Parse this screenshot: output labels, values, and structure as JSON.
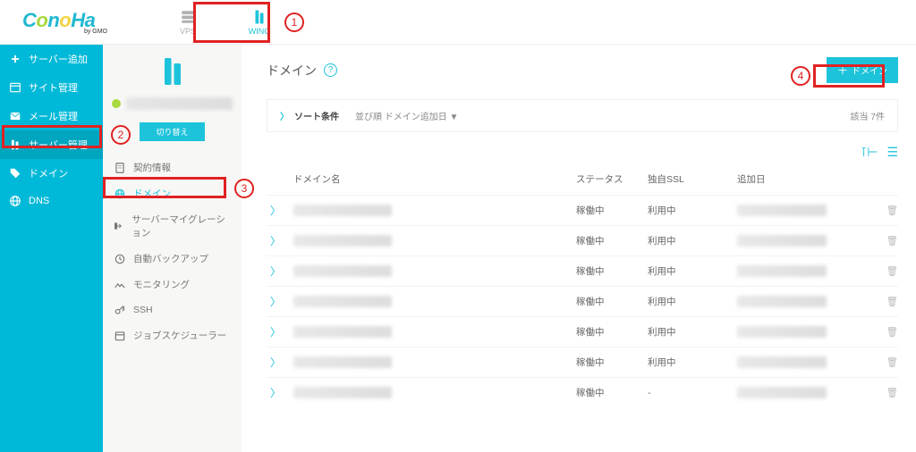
{
  "brand": {
    "name": "ConoHa",
    "sub": "by GMO"
  },
  "top_tabs": [
    {
      "label": "VPS",
      "icon": "server-icon",
      "active": false
    },
    {
      "label": "WING",
      "icon": "wing-icon",
      "active": true
    }
  ],
  "annotations": {
    "n1": "1",
    "n2": "2",
    "n3": "3",
    "n4": "4"
  },
  "sidebar1": {
    "items": [
      {
        "label": "サーバー追加",
        "icon": "plus-icon"
      },
      {
        "label": "サイト管理",
        "icon": "window-icon"
      },
      {
        "label": "メール管理",
        "icon": "mail-icon"
      },
      {
        "label": "サーバー管理",
        "icon": "server-icon",
        "active": true
      },
      {
        "label": "ドメイン",
        "icon": "tag-icon"
      },
      {
        "label": "DNS",
        "icon": "globe-icon"
      }
    ]
  },
  "sidebar2": {
    "switch_label": "切り替え",
    "items": [
      {
        "label": "契約情報",
        "icon": "doc-icon"
      },
      {
        "label": "ドメイン",
        "icon": "globe-icon",
        "active": true
      },
      {
        "label": "サーバーマイグレーション",
        "icon": "migrate-icon"
      },
      {
        "label": "自動バックアップ",
        "icon": "backup-icon"
      },
      {
        "label": "モニタリング",
        "icon": "monitor-icon"
      },
      {
        "label": "SSH",
        "icon": "key-icon"
      },
      {
        "label": "ジョブスケジューラー",
        "icon": "schedule-icon"
      }
    ]
  },
  "page": {
    "title": "ドメイン",
    "add_btn": "ドメイン",
    "sort_label": "ソート条件",
    "sort_sub": "並び順  ドメイン追加日 ▼",
    "result_count": "該当 7件"
  },
  "table": {
    "headers": {
      "domain": "ドメイン名",
      "status": "ステータス",
      "ssl": "独自SSL",
      "date": "追加日"
    },
    "rows": [
      {
        "status": "稼働中",
        "ssl": "利用中"
      },
      {
        "status": "稼働中",
        "ssl": "利用中"
      },
      {
        "status": "稼働中",
        "ssl": "利用中"
      },
      {
        "status": "稼働中",
        "ssl": "利用中"
      },
      {
        "status": "稼働中",
        "ssl": "利用中"
      },
      {
        "status": "稼働中",
        "ssl": "利用中"
      },
      {
        "status": "稼働中",
        "ssl": "-"
      }
    ]
  }
}
